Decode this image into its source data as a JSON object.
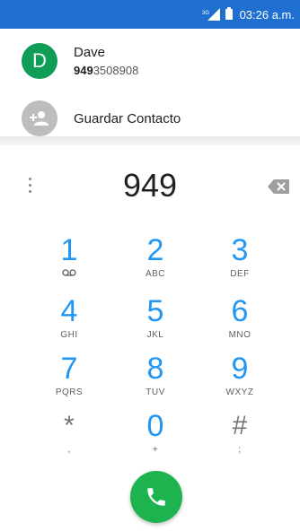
{
  "status_bar": {
    "network": "3G",
    "time": "03:26 a.m."
  },
  "contacts": {
    "suggested": {
      "initial": "D",
      "name": "Dave",
      "number_prefix": "949",
      "number_rest": "3508908"
    },
    "save_label": "Guardar Contacto"
  },
  "dialer": {
    "digits": "949",
    "keys": [
      {
        "digit": "1",
        "letters": ""
      },
      {
        "digit": "2",
        "letters": "ABC"
      },
      {
        "digit": "3",
        "letters": "DEF"
      },
      {
        "digit": "4",
        "letters": "GHI"
      },
      {
        "digit": "5",
        "letters": "JKL"
      },
      {
        "digit": "6",
        "letters": "MNO"
      },
      {
        "digit": "7",
        "letters": "PQRS"
      },
      {
        "digit": "8",
        "letters": "TUV"
      },
      {
        "digit": "9",
        "letters": "WXYZ"
      },
      {
        "digit": "*",
        "letters": ","
      },
      {
        "digit": "0",
        "letters": "+"
      },
      {
        "digit": "#",
        "letters": ";"
      }
    ]
  },
  "colors": {
    "status_bar": "#1f6fd1",
    "accent_blue": "#2196f3",
    "contact_avatar": "#0f9d58",
    "call_button": "#1db34e"
  }
}
